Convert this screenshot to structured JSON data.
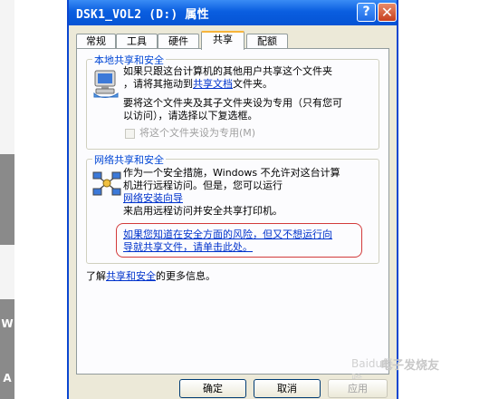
{
  "window": {
    "title": "DSK1_VOL2 (D:) 属性",
    "help_label": "?",
    "close_label": "✕"
  },
  "tabs": [
    {
      "label": "常规"
    },
    {
      "label": "工具"
    },
    {
      "label": "硬件"
    },
    {
      "label": "共享"
    },
    {
      "label": "配额"
    }
  ],
  "local_sharing": {
    "title": "本地共享和安全",
    "line1": "如果只跟这台计算机的其他用户共享这个文件夹",
    "line2_pre": "，请将其拖动到",
    "line2_link": "共享文档",
    "line2_post": "文件夹。",
    "line3": "要将这个文件夹及其子文件夹设为专用（只有您可",
    "line4": "以访问），请选择以下复选框。",
    "private_checkbox_label": "将这个文件夹设为专用(M)"
  },
  "network_sharing": {
    "title": "网络共享和安全",
    "line1": "作为一个安全措施，Windows 不允许对这台计算",
    "line2": "机进行远程访问。但是，您可以运行",
    "wizard_link": "网络安装向导",
    "line3": "来启用远程访问并安全共享打印机。",
    "risk_line1": "如果您知道在安全方面的风险，但又不想运行向",
    "risk_line2": "导就共享文件，请单击此处。"
  },
  "more_info": {
    "pre": "了解",
    "link": "共享和安全",
    "post": "的更多信息。"
  },
  "buttons": {
    "ok": "确定",
    "cancel": "取消",
    "apply": "应用"
  },
  "watermark": {
    "left": "Baidu经验",
    "right": "电子发烧友"
  },
  "side_strip": {
    "glyph1": "W",
    "glyph2": "A"
  },
  "colors": {
    "titlebar": "#0a5ee0",
    "accent_tab": "#f8b43a",
    "link": "#0033cc",
    "group_title": "#0046d5",
    "annotation": "#d23a3a"
  }
}
